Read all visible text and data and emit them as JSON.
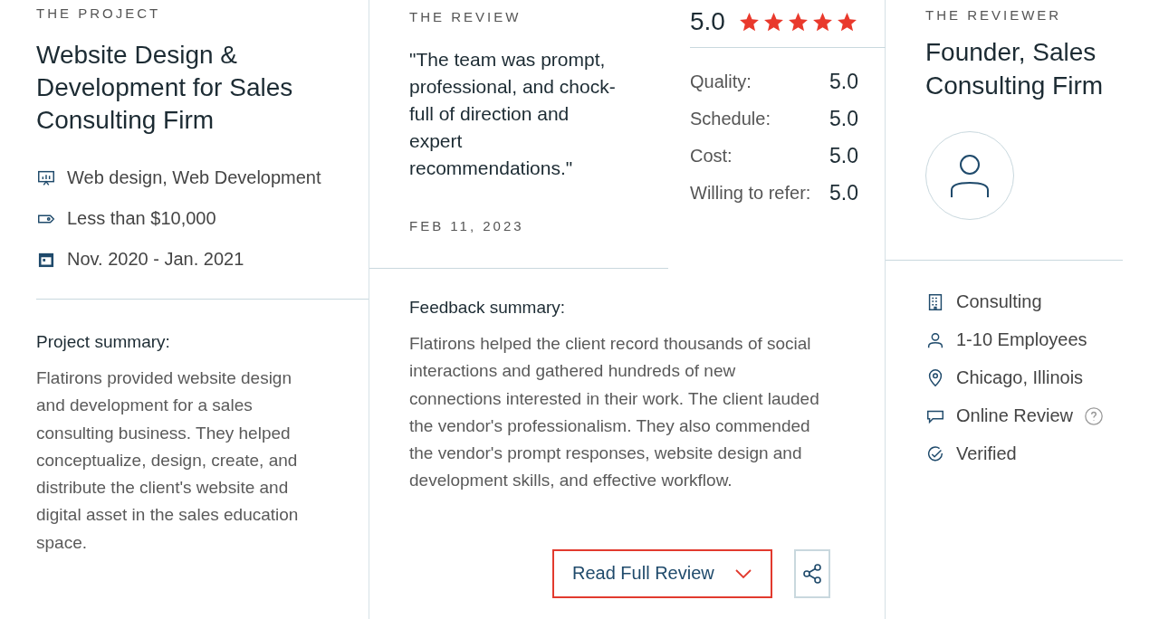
{
  "project": {
    "label": "THE PROJECT",
    "title": "Website Design & Development for Sales Consulting Firm",
    "meta": [
      {
        "kind": "service",
        "text": "Web design, Web Development"
      },
      {
        "kind": "budget",
        "text": "Less than $10,000"
      },
      {
        "kind": "date",
        "text": "Nov. 2020 - Jan. 2021"
      }
    ],
    "summary_title": "Project summary:",
    "summary": "Flatirons provided website design and development for a sales consulting business. They helped conceptualize, design, create, and distribute the client's website and digital asset in the sales education space."
  },
  "review": {
    "label": "THE REVIEW",
    "quote": "\"The team was prompt, professional, and chock-full of direction and expert recommendations.\"",
    "date": "FEB 11, 2023",
    "overall": "5.0",
    "stars": 5,
    "ratings": [
      {
        "label": "Quality:",
        "value": "5.0"
      },
      {
        "label": "Schedule:",
        "value": "5.0"
      },
      {
        "label": "Cost:",
        "value": "5.0"
      },
      {
        "label": "Willing to refer:",
        "value": "5.0"
      }
    ],
    "feedback_title": "Feedback summary:",
    "feedback": "Flatirons helped the client record thousands of social interactions and gathered hundreds of new connections interested in their work. The client lauded the vendor's professionalism. They also commended the vendor's prompt responses, website design and development skills, and effective workflow.",
    "read_button": "Read Full Review"
  },
  "reviewer": {
    "label": "THE REVIEWER",
    "title": "Founder, Sales Consulting Firm",
    "details": [
      {
        "kind": "industry",
        "text": "Consulting",
        "help": false
      },
      {
        "kind": "size",
        "text": "1-10 Employees",
        "help": false
      },
      {
        "kind": "location",
        "text": "Chicago, Illinois",
        "help": false
      },
      {
        "kind": "source",
        "text": "Online Review",
        "help": true
      },
      {
        "kind": "verified",
        "text": "Verified",
        "help": false
      }
    ]
  }
}
